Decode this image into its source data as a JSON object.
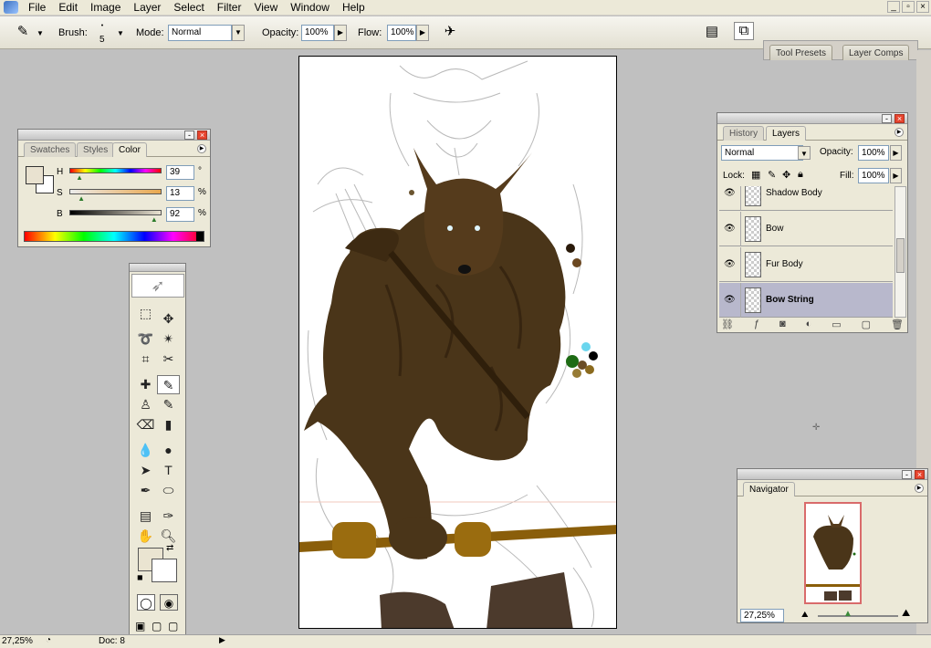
{
  "menu": [
    "File",
    "Edit",
    "Image",
    "Layer",
    "Select",
    "Filter",
    "View",
    "Window",
    "Help"
  ],
  "window_controls": [
    "_",
    "▫",
    "×"
  ],
  "options": {
    "brush_label": "Brush:",
    "brush_size": "5",
    "mode_label": "Mode:",
    "mode_value": "Normal",
    "opacity_label": "Opacity:",
    "opacity_value": "100%",
    "flow_label": "Flow:",
    "flow_value": "100%"
  },
  "well_tabs": [
    "Tool Presets",
    "Layer Comps"
  ],
  "color_panel": {
    "tabs": [
      "Swatches",
      "Styles",
      "Color"
    ],
    "foreground": "#e9e2d0",
    "background": "#ffffff",
    "sliders": [
      {
        "letter": "H",
        "value": "39",
        "unit": "°",
        "level": 0.11
      },
      {
        "letter": "S",
        "value": "13",
        "unit": "%",
        "level": 0.13
      },
      {
        "letter": "B",
        "value": "92",
        "unit": "%",
        "level": 0.92
      }
    ]
  },
  "toolbox": {
    "icons": [
      "marquee-icon",
      "move-icon",
      "lasso-icon",
      "magic-wand-icon",
      "crop-icon",
      "slice-icon",
      "healing-brush-icon",
      "brush-icon",
      "clone-stamp-icon",
      "history-brush-icon",
      "eraser-icon",
      "gradient-icon",
      "blur-icon",
      "dodge-icon",
      "path-selection-icon",
      "type-icon",
      "pen-icon",
      "ellipse-shape-icon",
      "notes-icon",
      "eyedropper-icon",
      "hand-icon",
      "zoom-icon"
    ],
    "foreground": "#eae4d1"
  },
  "layers_panel": {
    "tabs": [
      "History",
      "Layers"
    ],
    "blend_mode": "Normal",
    "opacity_label": "Opacity:",
    "opacity_value": "100%",
    "lock_label": "Lock:",
    "fill_label": "Fill:",
    "fill_value": "100%",
    "layers": [
      {
        "name": "Shadow Body",
        "selected": false
      },
      {
        "name": "Bow",
        "selected": false
      },
      {
        "name": "Fur Body",
        "selected": false
      },
      {
        "name": "Bow String",
        "selected": true
      }
    ]
  },
  "navigator": {
    "title": "Navigator",
    "zoom": "27,25%"
  },
  "status": {
    "zoom": "27,25%",
    "doc_label": "Doc: 8"
  }
}
